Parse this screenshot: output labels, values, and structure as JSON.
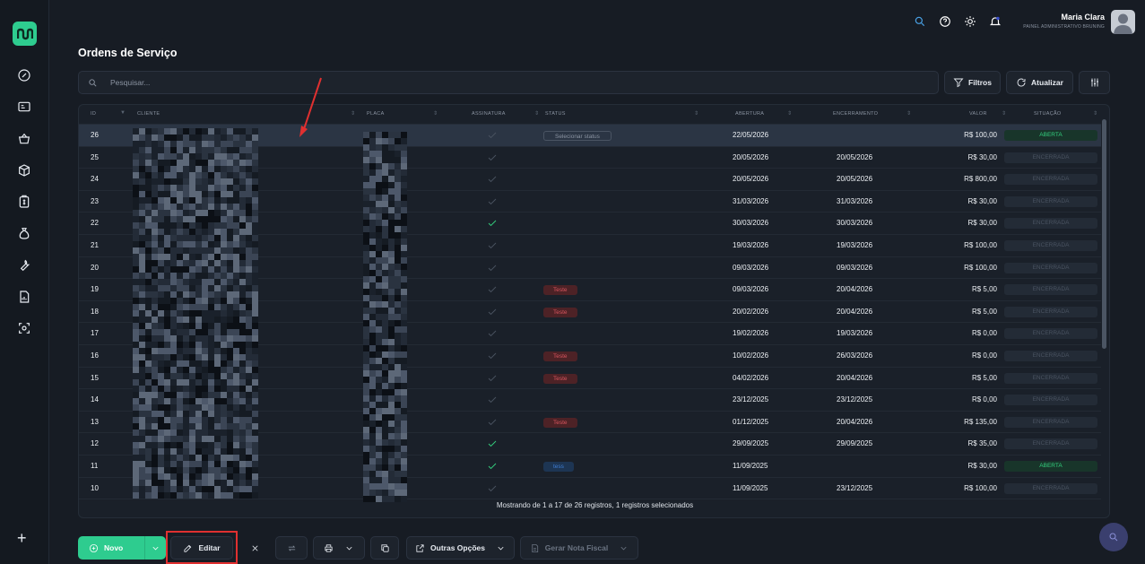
{
  "user": {
    "name": "Maria Clara",
    "role": "PAINEL ADMINISTRATIVO BRUNING"
  },
  "page": {
    "title": "Ordens de Serviço"
  },
  "search": {
    "placeholder": "Pesquisar..."
  },
  "toolbar": {
    "filters_label": "Filtros",
    "refresh_label": "Atualizar"
  },
  "table": {
    "columns": [
      "ID",
      "CLIENTE",
      "PLACA",
      "ASSINATURA",
      "STATUS",
      "ABERTURA",
      "ENCERRAMENTO",
      "VALOR",
      "SITUAÇÃO"
    ],
    "rows": [
      {
        "id": "26",
        "signed": false,
        "status": "Selecionar status",
        "status_type": "select",
        "opened": "22/05/2026",
        "closed": "",
        "value": "R$ 100,00",
        "situation": "ABERTA",
        "situation_type": "open",
        "selected": true
      },
      {
        "id": "25",
        "signed": false,
        "status": "",
        "status_type": "",
        "opened": "20/05/2026",
        "closed": "20/05/2026",
        "value": "R$ 30,00",
        "situation": "ENCERRADA",
        "situation_type": "closed"
      },
      {
        "id": "24",
        "signed": false,
        "status": "",
        "status_type": "",
        "opened": "20/05/2026",
        "closed": "20/05/2026",
        "value": "R$ 800,00",
        "situation": "ENCERRADA",
        "situation_type": "closed"
      },
      {
        "id": "23",
        "signed": false,
        "status": "",
        "status_type": "",
        "opened": "31/03/2026",
        "closed": "31/03/2026",
        "value": "R$ 30,00",
        "situation": "ENCERRADA",
        "situation_type": "closed"
      },
      {
        "id": "22",
        "signed": true,
        "status": "",
        "status_type": "",
        "opened": "30/03/2026",
        "closed": "30/03/2026",
        "value": "R$ 30,00",
        "situation": "ENCERRADA",
        "situation_type": "closed"
      },
      {
        "id": "21",
        "signed": false,
        "status": "",
        "status_type": "",
        "opened": "19/03/2026",
        "closed": "19/03/2026",
        "value": "R$ 100,00",
        "situation": "ENCERRADA",
        "situation_type": "closed"
      },
      {
        "id": "20",
        "signed": false,
        "status": "",
        "status_type": "",
        "opened": "09/03/2026",
        "closed": "09/03/2026",
        "value": "R$ 100,00",
        "situation": "ENCERRADA",
        "situation_type": "closed"
      },
      {
        "id": "19",
        "signed": false,
        "status": "Teste",
        "status_type": "teste",
        "opened": "09/03/2026",
        "closed": "20/04/2026",
        "value": "R$ 5,00",
        "situation": "ENCERRADA",
        "situation_type": "closed"
      },
      {
        "id": "18",
        "signed": false,
        "status": "Teste",
        "status_type": "teste",
        "opened": "20/02/2026",
        "closed": "20/04/2026",
        "value": "R$ 5,00",
        "situation": "ENCERRADA",
        "situation_type": "closed"
      },
      {
        "id": "17",
        "signed": false,
        "status": "",
        "status_type": "",
        "opened": "19/02/2026",
        "closed": "19/03/2026",
        "value": "R$ 0,00",
        "situation": "ENCERRADA",
        "situation_type": "closed"
      },
      {
        "id": "16",
        "signed": false,
        "status": "Teste",
        "status_type": "teste",
        "opened": "10/02/2026",
        "closed": "26/03/2026",
        "value": "R$ 0,00",
        "situation": "ENCERRADA",
        "situation_type": "closed"
      },
      {
        "id": "15",
        "signed": false,
        "status": "Teste",
        "status_type": "teste",
        "opened": "04/02/2026",
        "closed": "20/04/2026",
        "value": "R$ 5,00",
        "situation": "ENCERRADA",
        "situation_type": "closed"
      },
      {
        "id": "14",
        "signed": false,
        "status": "",
        "status_type": "",
        "opened": "23/12/2025",
        "closed": "23/12/2025",
        "value": "R$ 0,00",
        "situation": "ENCERRADA",
        "situation_type": "closed"
      },
      {
        "id": "13",
        "signed": false,
        "status": "Teste",
        "status_type": "teste",
        "opened": "01/12/2025",
        "closed": "20/04/2026",
        "value": "R$ 135,00",
        "situation": "ENCERRADA",
        "situation_type": "closed"
      },
      {
        "id": "12",
        "signed": true,
        "status": "",
        "status_type": "",
        "opened": "29/09/2025",
        "closed": "29/09/2025",
        "value": "R$ 35,00",
        "situation": "ENCERRADA",
        "situation_type": "closed"
      },
      {
        "id": "11",
        "signed": true,
        "status": "tess",
        "status_type": "tess",
        "opened": "11/09/2025",
        "closed": "",
        "value": "R$ 30,00",
        "situation": "ABERTA",
        "situation_type": "open"
      },
      {
        "id": "10",
        "signed": false,
        "status": "",
        "status_type": "",
        "opened": "11/09/2025",
        "closed": "23/12/2025",
        "value": "R$ 100,00",
        "situation": "ENCERRADA",
        "situation_type": "closed"
      }
    ],
    "footer": "Mostrando de 1 a 17 de 26 registros, 1 registros selecionados"
  },
  "actions": {
    "new_label": "Novo",
    "edit_label": "Editar",
    "more_label": "Outras Opções",
    "invoice_label": "Gerar Nota Fiscal"
  },
  "colors": {
    "accent": "#2ecc8f",
    "open": "#34d17f",
    "danger": "#d6545d",
    "highlight": "#e03030"
  }
}
